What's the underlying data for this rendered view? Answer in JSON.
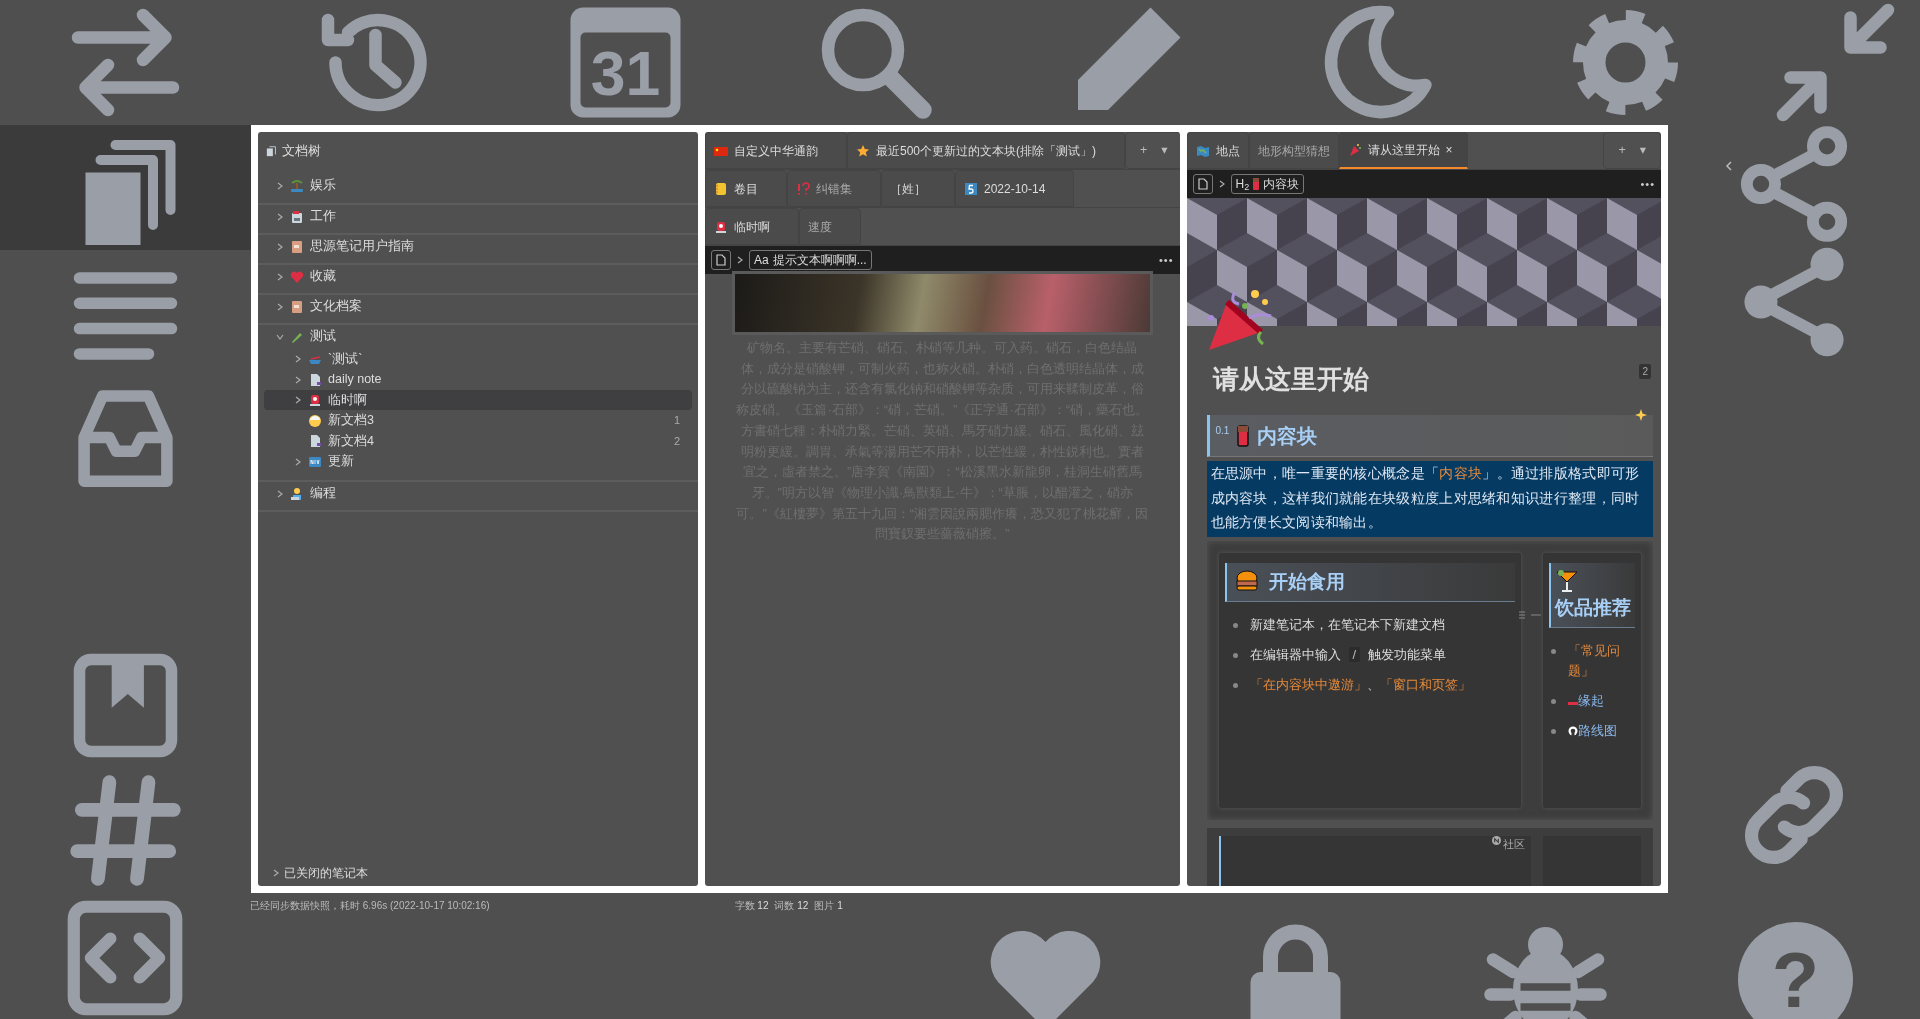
{
  "toolbar": {
    "calendar_day": "31"
  },
  "help_icon": {
    "glyph": "?"
  },
  "doc_tree": {
    "title": "文档树",
    "notebooks": [
      {
        "label": "娱乐",
        "expanded": false
      },
      {
        "label": "工作",
        "expanded": false
      },
      {
        "label": "思源笔记用户指南",
        "expanded": false
      },
      {
        "label": "收藏",
        "expanded": false
      },
      {
        "label": "文化档案",
        "expanded": false
      },
      {
        "label": "测试",
        "expanded": true,
        "children": [
          {
            "label": "`测试`",
            "has_children": true,
            "selected": false
          },
          {
            "label": "daily note",
            "has_children": true,
            "selected": false
          },
          {
            "label": "临时啊",
            "has_children": true,
            "selected": true
          },
          {
            "label": "新文档3",
            "has_children": false,
            "selected": false,
            "count": "1"
          },
          {
            "label": "新文档4",
            "has_children": false,
            "selected": false,
            "count": "2"
          },
          {
            "label": "更新",
            "has_children": true,
            "selected": false
          }
        ]
      },
      {
        "label": "编程",
        "expanded": false
      }
    ],
    "closed_notebooks": "已关闭的笔记本"
  },
  "middle_panel": {
    "tab_rows": [
      [
        {
          "label": "自定义中华通韵",
          "selected": false
        },
        {
          "label": "最近500个更新过的文本块(排除「测试」)",
          "selected": false
        }
      ],
      [
        {
          "label": "卷目",
          "selected": false
        },
        {
          "label": "纠错集",
          "selected": false
        },
        {
          "label": "［姓］",
          "selected": false
        },
        {
          "label": "2022-10-14",
          "selected": false
        }
      ],
      [
        {
          "label": "临时啊",
          "selected": false
        },
        {
          "label": "速度",
          "selected": false
        }
      ]
    ],
    "tab_actions": [
      "+",
      "▾"
    ],
    "breadcrumb": {
      "prefix": "Aa",
      "chip": "提示文本啊啊啊...",
      "more": "•••"
    },
    "paragraph": "矿物名。主要有芒硝、硝石、朴硝等几种。可入药。硝石，白色结晶体，成分是硝酸钾，可制火药，也称火硝。朴硝，白色透明结晶体，成分以硫酸钠为主，还含有氯化钠和硝酸钾等杂质，可用来鞣制皮革，俗称皮硝。《玉篇·石部》：“硝，芒硝。”《正字通·石部》：“硝，藥石也。方書硝七種：朴硝力緊。芒硝、英硝、馬牙硝力緩。硝石、風化硝、玆明粉更緩。調胃、承氣等湯用芒不用朴，以芒性緩，朴性鋭利也。實者宜之，虛者禁之。”唐李賀《南園》：“松溪黑水新龍卵，桂洞生硝舊馬牙。”明方以智《物理小識·鳥獸類上·牛》：“草脹，以醋灌之，硝亦可。”《紅樓夢》第五十九回：“湘雲因說兩腮作癢，恐又犯了桃花癬，因問寶釵要些薔薇硝擦。”"
  },
  "right_panel": {
    "tabs": [
      {
        "label": "地点",
        "selected": false
      },
      {
        "label": "地形构型猜想",
        "selected": false
      },
      {
        "label": "请从这里开始",
        "selected": true,
        "close": "×"
      }
    ],
    "tab_actions": [
      "+",
      "▾"
    ],
    "breadcrumb": {
      "heading_level": "H$_{2}$",
      "chip": "内容块",
      "more": "•••"
    },
    "title": "请从这里开始",
    "badge": "2",
    "heading": {
      "number": "0.1",
      "text": "内容块"
    },
    "quote": [
      {
        "kind": "text",
        "text": "在思源中，唯一重要的核心概念是「"
      },
      {
        "kind": "link",
        "text": "内容块"
      },
      {
        "kind": "text",
        "text": "」。通过排版格式即可形成内容块，这样我们就能在块级粒度上对思绪和知识进行整理，同时也能方便长文阅读和输出。"
      }
    ],
    "cards": [
      {
        "title": "开始食用",
        "items": [
          [
            {
              "kind": "text",
              "text": "新建笔记本，在笔记本下新建文档"
            }
          ],
          [
            {
              "kind": "text",
              "text": "在编辑器中输入"
            },
            {
              "kind": "code",
              "text": "/"
            },
            {
              "kind": "text",
              "text": "触发功能菜单"
            }
          ],
          [
            {
              "kind": "link",
              "text": "「在内容块中遨游」"
            },
            {
              "kind": "text",
              "text": "、"
            },
            {
              "kind": "link",
              "text": "「窗口和页签」"
            }
          ]
        ]
      },
      {
        "title": "饮品推荐",
        "items": [
          [
            {
              "kind": "link",
              "text": "「常见问题」"
            }
          ],
          [
            {
              "kind": "ref",
              "text": "缘起"
            }
          ],
          [
            {
              "kind": "ref",
              "text": "路线图"
            }
          ]
        ]
      }
    ],
    "next_row_label": "社区"
  },
  "status_bar": {
    "sync": "已经同步数据快照，耗时 6.96s (2022-10-17 10:02:16)",
    "counts": [
      {
        "label": "字数",
        "value": "12"
      },
      {
        "label": "词数",
        "value": "12"
      },
      {
        "label": "图片",
        "value": "1"
      }
    ]
  }
}
